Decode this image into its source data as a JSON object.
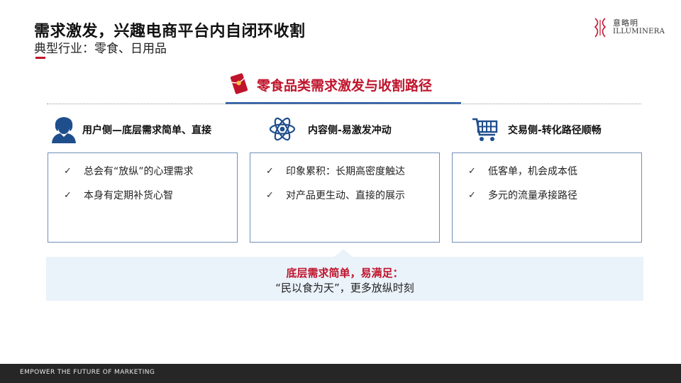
{
  "header": {
    "title": "需求激发，兴趣电商平台内自闭环收割",
    "subtitle": "典型行业：零食、日用品"
  },
  "logo": {
    "cn": "意略明",
    "en": "ILLUMINERA"
  },
  "headline": {
    "text": "零食品类需求激发与收割路径",
    "icon": "red-envelope-icon"
  },
  "columns": [
    {
      "label": "用户侧—底层需求简单、直接",
      "icon": "user-icon",
      "items": [
        "总会有“放纵”的心理需求",
        "本身有定期补货心智"
      ]
    },
    {
      "label": "内容侧-易激发冲动",
      "icon": "atom-icon",
      "items": [
        "印象累积：长期高密度触达",
        "对产品更生动、直接的展示"
      ]
    },
    {
      "label": "交易侧-转化路径顺畅",
      "icon": "shopping-cart-icon",
      "items": [
        "低客单，机会成本低",
        "多元的流量承接路径"
      ]
    }
  ],
  "callout": {
    "line1": "底层需求简单，易满足：",
    "line2": "“民以食为天”，更多放纵时刻"
  },
  "footer": {
    "text": "EMPOWER THE FUTURE OF MARKETING"
  },
  "colors": {
    "accent_red": "#c0142c",
    "accent_blue": "#2e5fa8",
    "icon_blue": "#1f4e8c",
    "callout_bg": "#eaf2fa",
    "footer_bg": "#262626"
  },
  "check_glyph": "✓"
}
